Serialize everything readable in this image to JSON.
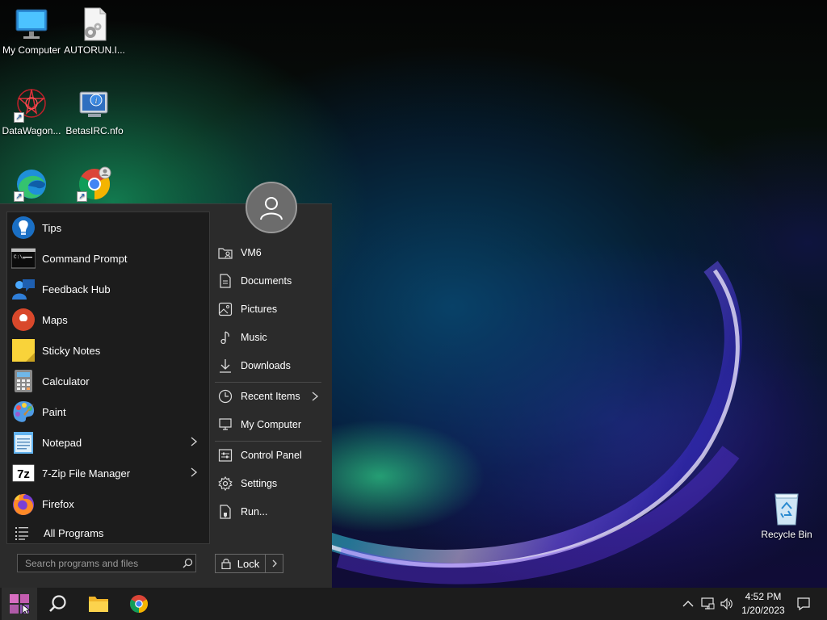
{
  "desktop": {
    "icons": [
      {
        "label": "My Computer",
        "icon": "monitor-icon"
      },
      {
        "label": "AUTORUN.I...",
        "icon": "settings-file-icon"
      },
      {
        "label": "DataWagon...",
        "icon": "datawagon-icon"
      },
      {
        "label": "BetasIRC.nfo",
        "icon": "info-file-icon"
      },
      {
        "label": "",
        "icon": "edge-icon"
      },
      {
        "label": "",
        "icon": "chrome-icon"
      },
      {
        "label": "Recycle Bin",
        "icon": "recycle-bin-icon"
      }
    ]
  },
  "start_menu": {
    "programs": [
      {
        "label": "Tips",
        "icon": "tips-icon",
        "has_submenu": false
      },
      {
        "label": "Command Prompt",
        "icon": "command-prompt-icon",
        "has_submenu": false
      },
      {
        "label": "Feedback Hub",
        "icon": "feedback-hub-icon",
        "has_submenu": false
      },
      {
        "label": "Maps",
        "icon": "maps-icon",
        "has_submenu": false
      },
      {
        "label": "Sticky Notes",
        "icon": "sticky-notes-icon",
        "has_submenu": false
      },
      {
        "label": "Calculator",
        "icon": "calculator-icon",
        "has_submenu": false
      },
      {
        "label": "Paint",
        "icon": "paint-icon",
        "has_submenu": false
      },
      {
        "label": "Notepad",
        "icon": "notepad-icon",
        "has_submenu": true
      },
      {
        "label": "7-Zip File Manager",
        "icon": "7zip-icon",
        "has_submenu": true
      },
      {
        "label": "Firefox",
        "icon": "firefox-icon",
        "has_submenu": false
      }
    ],
    "all_programs_label": "All Programs",
    "search_placeholder": "Search programs and files",
    "places": [
      {
        "label": "VM6",
        "icon": "user-folder-icon"
      },
      {
        "label": "Documents",
        "icon": "document-icon"
      },
      {
        "label": "Pictures",
        "icon": "picture-icon"
      },
      {
        "label": "Music",
        "icon": "music-icon"
      },
      {
        "label": "Downloads",
        "icon": "download-icon"
      },
      {
        "label": "Recent Items",
        "icon": "clock-icon",
        "has_submenu": true
      },
      {
        "label": "My Computer",
        "icon": "computer-icon"
      },
      {
        "label": "Control Panel",
        "icon": "control-panel-icon"
      },
      {
        "label": "Settings",
        "icon": "gear-icon"
      },
      {
        "label": "Run...",
        "icon": "run-icon"
      }
    ],
    "lock_label": "Lock"
  },
  "taskbar": {
    "clock_time": "4:52 PM",
    "clock_date": "1/20/2023"
  }
}
